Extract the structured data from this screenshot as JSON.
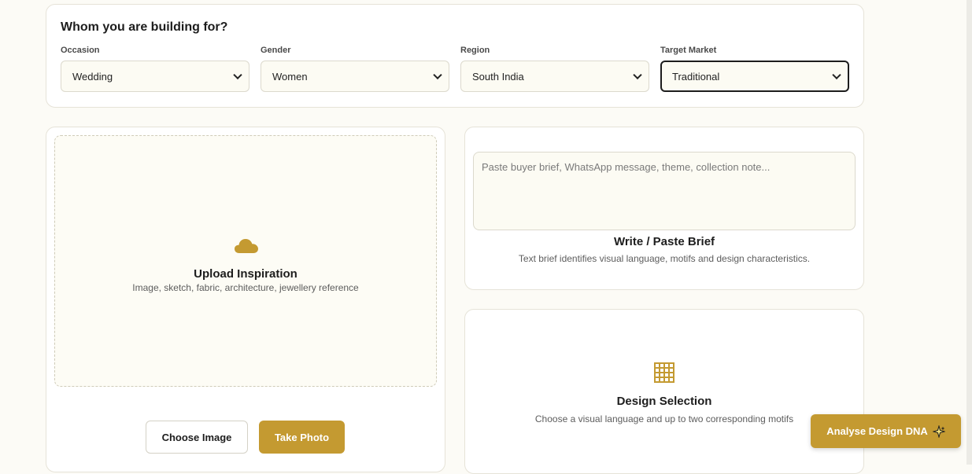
{
  "colors": {
    "accent": "#c49a31",
    "background": "#fcfbf6"
  },
  "filters": {
    "title": "Whom you are building for?",
    "fields": [
      {
        "label": "Occasion",
        "value": "Wedding"
      },
      {
        "label": "Gender",
        "value": "Women"
      },
      {
        "label": "Region",
        "value": "South India"
      },
      {
        "label": "Target Market",
        "value": "Traditional"
      }
    ]
  },
  "upload": {
    "icon": "cloud-icon",
    "title": "Upload Inspiration",
    "subtitle": "Image, sketch, fabric, architecture, jewellery reference",
    "choose_label": "Choose Image",
    "photo_label": "Take Photo"
  },
  "brief": {
    "placeholder": "Paste buyer brief, WhatsApp message, theme, collection note...",
    "title": "Write / Paste Brief",
    "subtitle": "Text brief identifies visual language, motifs and design characteristics."
  },
  "design": {
    "icon": "grid-icon",
    "title": "Design Selection",
    "subtitle": "Choose a visual language and up to two corresponding motifs"
  },
  "cta": {
    "label": "Analyse Design DNA",
    "icon": "sparkle-icon"
  }
}
